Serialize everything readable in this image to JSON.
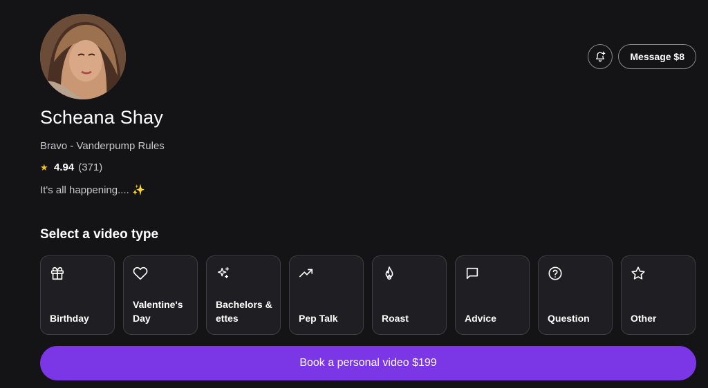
{
  "profile": {
    "name": "Scheana Shay",
    "subtitle": "Bravo - Vanderpump Rules",
    "rating": "4.94",
    "review_count": "(371)",
    "tagline": "It's all happening....",
    "tagline_emoji": "✨"
  },
  "header": {
    "message_label": "Message $8",
    "bell_icon": "bell-plus-icon"
  },
  "video_types": {
    "title": "Select a video type",
    "items": [
      {
        "label": "Birthday",
        "icon": "gift-icon"
      },
      {
        "label": "Valentine's Day",
        "icon": "heart-icon"
      },
      {
        "label": "Bachelors & ettes",
        "icon": "sparkles-icon"
      },
      {
        "label": "Pep Talk",
        "icon": "trending-up-icon"
      },
      {
        "label": "Roast",
        "icon": "flame-icon"
      },
      {
        "label": "Advice",
        "icon": "chat-bubble-icon"
      },
      {
        "label": "Question",
        "icon": "question-circle-icon"
      },
      {
        "label": "Other",
        "icon": "star-icon"
      }
    ]
  },
  "book": {
    "label": "Book a personal video $199"
  },
  "colors": {
    "background": "#141315",
    "card": "#1f1e22",
    "accent": "#7b36e6",
    "star": "#f5c518"
  }
}
